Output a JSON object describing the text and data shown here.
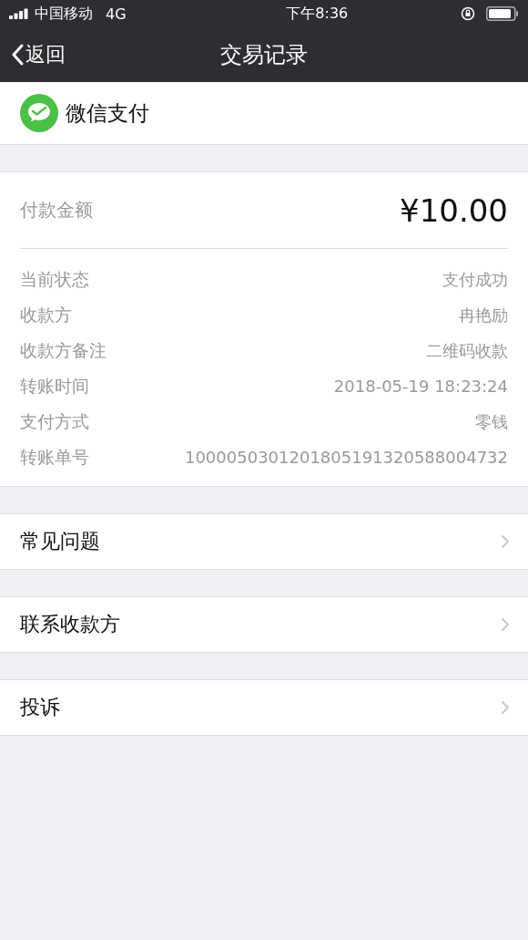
{
  "status_bar": {
    "carrier": "中国移动",
    "network": "4G",
    "time": "下午8:36"
  },
  "nav_bar": {
    "back": "返回",
    "title": "交易记录"
  },
  "merchant": {
    "name": "微信支付"
  },
  "amount": {
    "label": "付款金额",
    "value": "¥10.00"
  },
  "details": [
    {
      "label": "当前状态",
      "value": "支付成功"
    },
    {
      "label": "收款方",
      "value": "冉艳励"
    },
    {
      "label": "收款方备注",
      "value": "二维码收款"
    },
    {
      "label": "转账时间",
      "value": "2018-05-19 18:23:24"
    },
    {
      "label": "支付方式",
      "value": "零钱"
    },
    {
      "label": "转账单号",
      "value": "1000050301201805191320588004732"
    }
  ],
  "menu": [
    {
      "label": "常见问题"
    },
    {
      "label": "联系收款方"
    },
    {
      "label": "投诉"
    }
  ]
}
